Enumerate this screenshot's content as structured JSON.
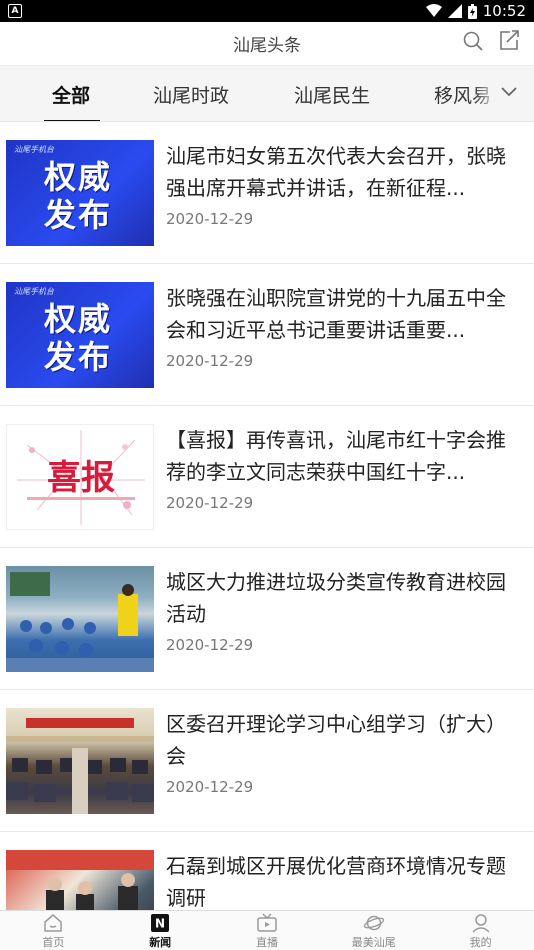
{
  "status": {
    "time": "10:52",
    "left_icon": "android-notification-icon",
    "right_icons": [
      "wifi-icon",
      "signal-icon",
      "battery-icon"
    ]
  },
  "header": {
    "title": "汕尾头条",
    "icons": [
      "search-icon",
      "share-icon"
    ]
  },
  "tabs": [
    {
      "label": "全部",
      "active": true
    },
    {
      "label": "汕尾时政",
      "active": false
    },
    {
      "label": "汕尾民生",
      "active": false
    },
    {
      "label": "移风易",
      "active": false
    }
  ],
  "thumb_text": {
    "authority": "权威",
    "release": "发布",
    "caption": "汕尾手机台",
    "good_news": "喜报"
  },
  "news": [
    {
      "title": "汕尾市妇女第五次代表大会召开，张晓强出席开幕式并讲话，在新征程...",
      "date": "2020-12-29",
      "thumb": "authority"
    },
    {
      "title": "张晓强在汕职院宣讲党的十九届五中全会和习近平总书记重要讲话重要...",
      "date": "2020-12-29",
      "thumb": "authority"
    },
    {
      "title": "【喜报】再传喜讯，汕尾市红十字会推荐的李立文同志荣获中国红十字...",
      "date": "2020-12-29",
      "thumb": "good-news"
    },
    {
      "title": "城区大力推进垃圾分类宣传教育进校园活动",
      "date": "2020-12-29",
      "thumb": "classroom"
    },
    {
      "title": "区委召开理论学习中心组学习（扩大）会",
      "date": "2020-12-29",
      "thumb": "meeting"
    },
    {
      "title": "石磊到城区开展优化营商环境情况专题调研",
      "date": "",
      "thumb": "street"
    }
  ],
  "bottom_nav": [
    {
      "label": "首页",
      "icon": "home-icon",
      "active": false
    },
    {
      "label": "新闻",
      "icon": "news-icon",
      "active": true
    },
    {
      "label": "直播",
      "icon": "live-tv-icon",
      "active": false
    },
    {
      "label": "最美汕尾",
      "icon": "planet-icon",
      "active": false
    },
    {
      "label": "我的",
      "icon": "profile-icon",
      "active": false
    }
  ]
}
